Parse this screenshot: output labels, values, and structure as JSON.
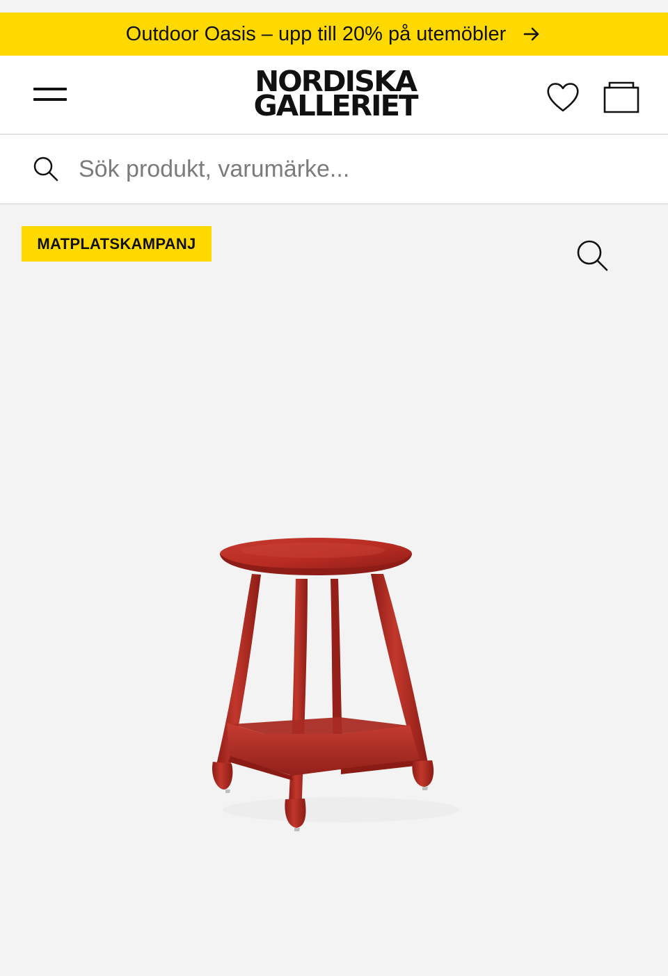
{
  "promo": {
    "text": "Outdoor Oasis – upp till 20% på utemöbler",
    "arrow_icon": "arrow-right-icon"
  },
  "header": {
    "menu_icon": "hamburger-menu-icon",
    "logo_line_1": "NORDISKA",
    "logo_line_2": "GALLERIET",
    "wishlist_icon": "heart-icon",
    "cart_icon": "shopping-bag-icon"
  },
  "search": {
    "placeholder": "Sök produkt, varumärke...",
    "value": "",
    "icon": "search-icon"
  },
  "product": {
    "badge": "MATPLATSKAMPANJ",
    "zoom_icon": "zoom-search-icon",
    "image_label": "red wooden stool",
    "image_color": "#b72b21"
  },
  "colors": {
    "promo_background": "#ffd900",
    "badge_background": "#ffd900",
    "page_background": "#f3f3f3",
    "header_background": "#ffffff"
  }
}
